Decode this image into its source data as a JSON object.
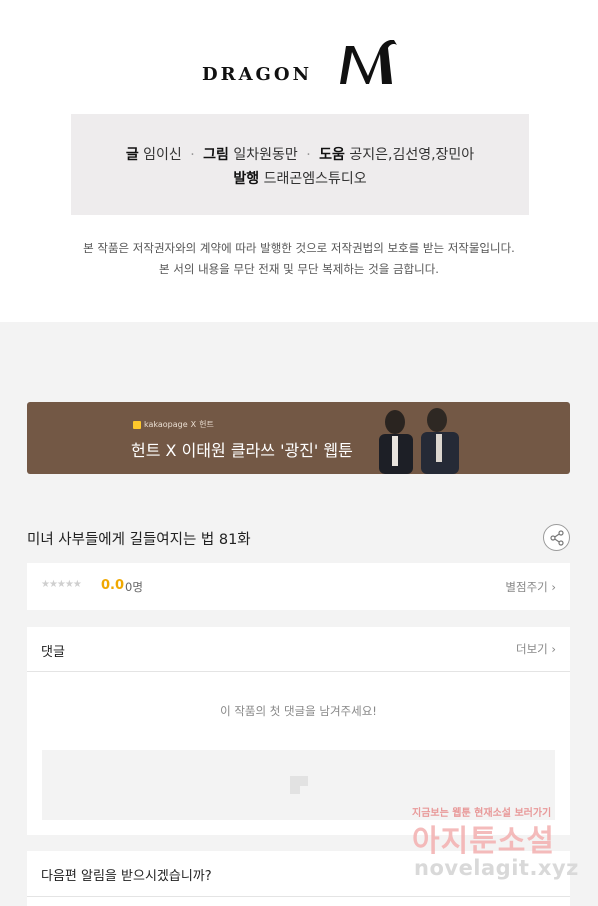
{
  "header": {
    "logo_text": "DRAGON",
    "logo_mark": "M"
  },
  "credits": {
    "writer_label": "글",
    "writer": "임이신",
    "art_label": "그림",
    "art": "일차원동만",
    "assist_label": "도움",
    "assist": "공지은,김선영,장민아",
    "publisher_label": "발행",
    "publisher": "드래곤엠스튜디오",
    "separator": "·"
  },
  "notice": {
    "line1": "본 작품은 저작권자와의 계약에 따라 발행한 것으로 저작권법의 보호를 받는 저작물입니다.",
    "line2": "본 서의 내용을 무단 전재 및 무단 복제하는 것을 금합니다."
  },
  "banner": {
    "brand": "kakaopage",
    "brand_x": "X",
    "brand_partner": "헌트",
    "title": "헌트 X 이태원 클라쓰 '광진' 웹툰",
    "colors": {
      "background": "#735845",
      "brand_square": "#ffc82c"
    }
  },
  "episode": {
    "title": "미녀 사부들에게 길들여지는 법 81화"
  },
  "rating": {
    "stars": "★★★★★",
    "score": "0.0",
    "count": "0명",
    "action": "별점주기",
    "score_color": "#f0a800"
  },
  "comments": {
    "title": "댓글",
    "more": "더보기",
    "empty_message": "이 작품의 첫 댓글을 남겨주세요!"
  },
  "notify": {
    "question": "다음편 알림을 받으시겠습니까?"
  },
  "watermark": {
    "top": "지금보는 웹툰 현재소설 보러가기",
    "middle": "아지툰소설",
    "bottom": "novelagit.xyz"
  },
  "icons": {
    "share": "share-icon",
    "chevron": "chevron-right-icon",
    "placeholder": "image-placeholder-icon"
  }
}
